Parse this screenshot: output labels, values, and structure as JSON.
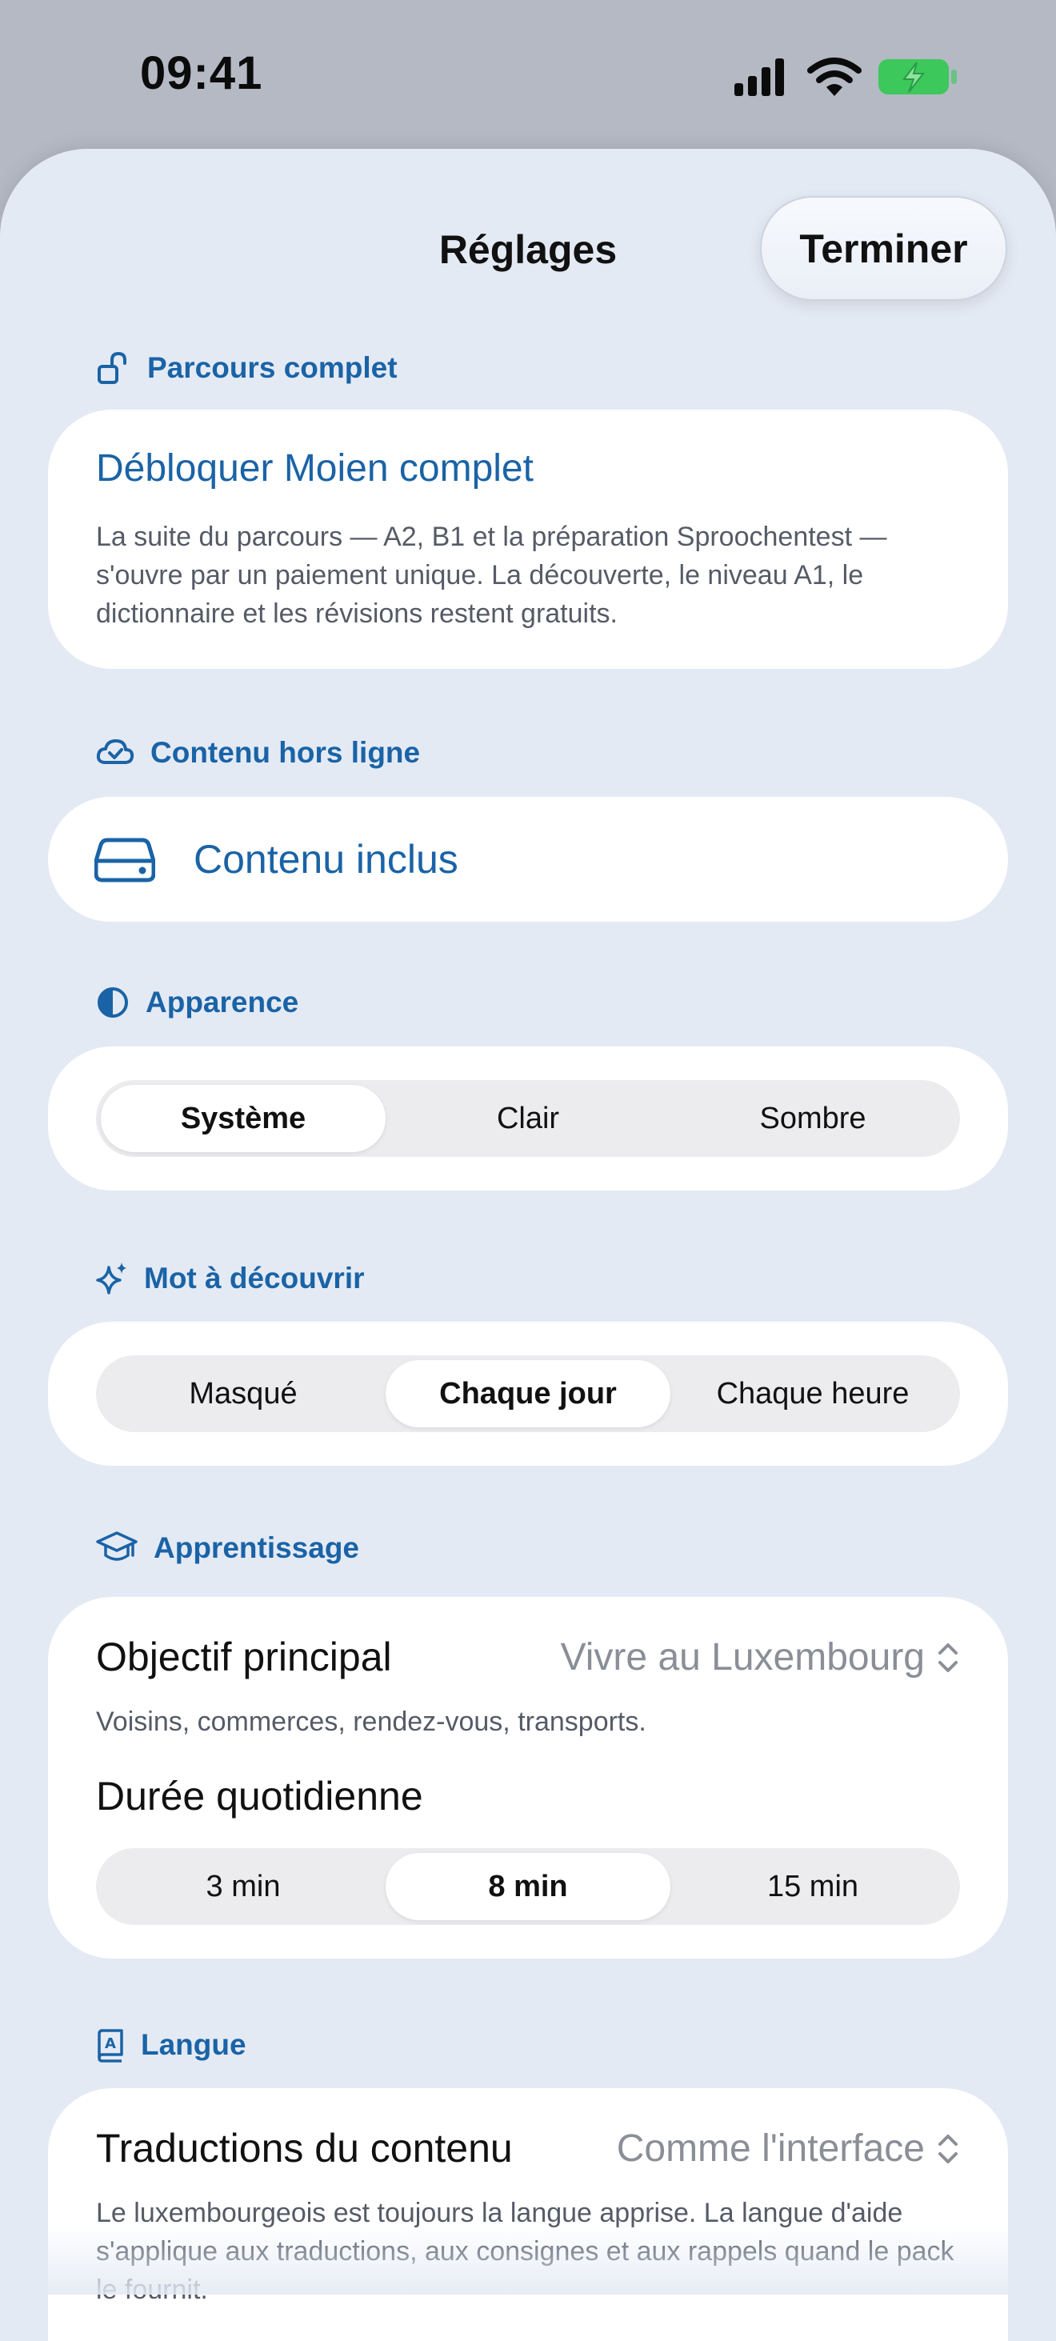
{
  "status_bar": {
    "time": "09:41"
  },
  "navigation": {
    "title": "Réglages",
    "done_label": "Terminer"
  },
  "sections": {
    "full_course": {
      "header": "Parcours complet",
      "title": "Débloquer Moien complet",
      "description": "La suite du parcours — A2, B1 et la préparation Sproochentest — s'ouvre par un paiement unique. La découverte, le niveau A1, le dictionnaire et les révisions restent gratuits."
    },
    "offline": {
      "header": "Contenu hors ligne",
      "row_label": "Contenu inclus"
    },
    "appearance": {
      "header": "Apparence",
      "options": [
        "Système",
        "Clair",
        "Sombre"
      ],
      "selected": "Système"
    },
    "word_of_day": {
      "header": "Mot à découvrir",
      "options": [
        "Masqué",
        "Chaque jour",
        "Chaque heure"
      ],
      "selected": "Chaque jour"
    },
    "learning": {
      "header": "Apprentissage",
      "goal_label": "Objectif principal",
      "goal_value": "Vivre au Luxembourg",
      "goal_description": "Voisins, commerces, rendez-vous, transports.",
      "duration_label": "Durée quotidienne",
      "duration_options": [
        "3 min",
        "8 min",
        "15 min"
      ],
      "duration_selected": "8 min"
    },
    "language": {
      "header": "Langue",
      "translation_label": "Traductions du contenu",
      "translation_value": "Comme l'interface",
      "description": "Le luxembourgeois est toujours la langue apprise. La langue d'aide s'applique aux traductions, aux consignes et aux rappels quand le pack le fournit."
    }
  },
  "colors": {
    "accent": "#1a63a6",
    "sheet_background": "#e4eaf4",
    "card_background": "#ffffff",
    "battery": "#3cc85a"
  },
  "icons": {
    "full_course": "lock-open-icon",
    "offline": "cloud-check-icon",
    "offline_row": "drive-icon",
    "appearance": "half-circle-icon",
    "word_of_day": "sparkles-icon",
    "learning": "graduation-cap-icon",
    "language": "book-icon"
  }
}
